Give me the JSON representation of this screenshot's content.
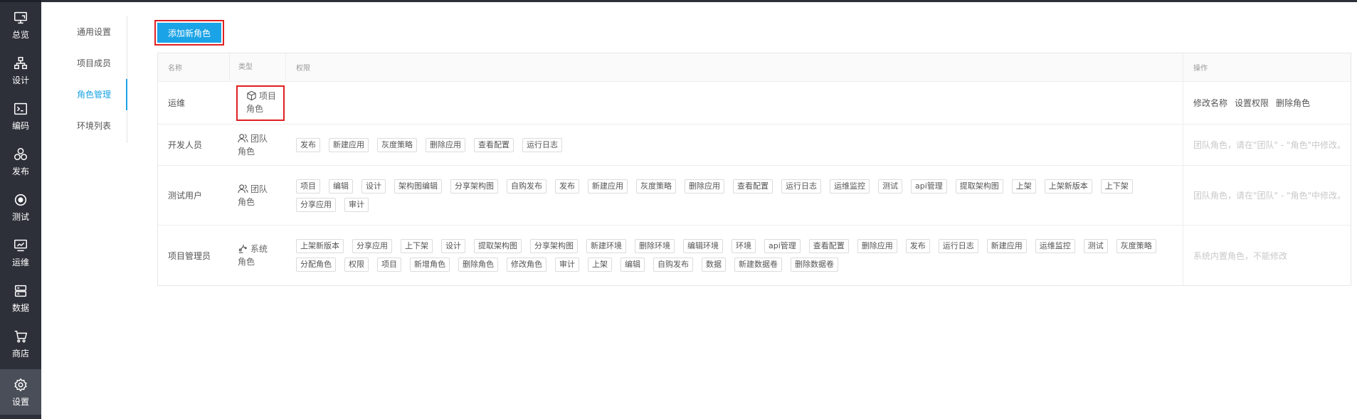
{
  "rail": [
    {
      "label": "总览",
      "icon": "monitor-icon"
    },
    {
      "label": "设计",
      "icon": "hierarchy-icon"
    },
    {
      "label": "编码",
      "icon": "terminal-icon"
    },
    {
      "label": "发布",
      "icon": "circles-icon"
    },
    {
      "label": "测试",
      "icon": "target-icon"
    },
    {
      "label": "运维",
      "icon": "monitor-chart-icon"
    },
    {
      "label": "数据",
      "icon": "database-icon"
    },
    {
      "label": "商店",
      "icon": "cart-icon"
    },
    {
      "label": "设置",
      "icon": "gear-icon",
      "active": true
    }
  ],
  "subnav": [
    {
      "label": "通用设置"
    },
    {
      "label": "项目成员"
    },
    {
      "label": "角色管理",
      "active": true
    },
    {
      "label": "环境列表"
    }
  ],
  "add_button": "添加新角色",
  "table": {
    "headers": {
      "name": "名称",
      "type": "类型",
      "perm": "权限",
      "ops": "操作"
    },
    "rows": [
      {
        "name": "运维",
        "type_line1": "项目",
        "type_line2": "角色",
        "type_icon": "cube-icon",
        "perms": [],
        "ops": [
          "修改名称",
          "设置权限",
          "删除角色"
        ],
        "ops_text": ""
      },
      {
        "name": "开发人员",
        "type_line1": "团队",
        "type_line2": "角色",
        "type_icon": "users-icon",
        "perms": [
          "发布",
          "新建应用",
          "灰度策略",
          "删除应用",
          "查看配置",
          "运行日志"
        ],
        "ops": [],
        "ops_text": "团队角色，请在\"团队\" - \"角色\"中修改。"
      },
      {
        "name": "测试用户",
        "type_line1": "团队",
        "type_line2": "角色",
        "type_icon": "users-icon",
        "perms": [
          "项目",
          "编辑",
          "设计",
          "架构图编辑",
          "分享架构图",
          "自购发布",
          "发布",
          "新建应用",
          "灰度策略",
          "删除应用",
          "查看配置",
          "运行日志",
          "运维监控",
          "测试",
          "api管理",
          "提取架构图",
          "上架",
          "上架新版本",
          "上下架",
          "分享应用",
          "审计"
        ],
        "ops": [],
        "ops_text": "团队角色，请在\"团队\" - \"角色\"中修改。"
      },
      {
        "name": "项目管理员",
        "type_line1": "系统",
        "type_line2": "角色",
        "type_icon": "robot-arm-icon",
        "perms": [
          "上架新版本",
          "分享应用",
          "上下架",
          "设计",
          "提取架构图",
          "分享架构图",
          "新建环境",
          "删除环境",
          "编辑环境",
          "环境",
          "api管理",
          "查看配置",
          "删除应用",
          "发布",
          "运行日志",
          "新建应用",
          "运维监控",
          "测试",
          "灰度策略",
          "分配角色",
          "权限",
          "项目",
          "新增角色",
          "删除角色",
          "修改角色",
          "审计",
          "上架",
          "编辑",
          "自购发布",
          "数据",
          "新建数据卷",
          "删除数据卷"
        ],
        "ops": [],
        "ops_text": "系统内置角色，不能修改"
      }
    ]
  }
}
